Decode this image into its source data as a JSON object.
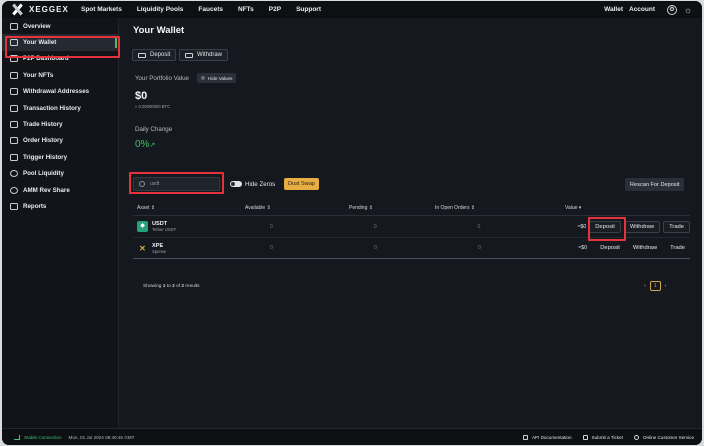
{
  "brand": {
    "name": "XEGGEX"
  },
  "topnav": {
    "items": [
      "Spot Markets",
      "Liquidity Pools",
      "Faucets",
      "NFTs",
      "P2P",
      "Support"
    ],
    "wallet": "Wallet",
    "account": "Account"
  },
  "sidebar": {
    "items": [
      {
        "label": "Overview",
        "icon": "overview-icon"
      },
      {
        "label": "Your Wallet",
        "icon": "wallet-icon"
      },
      {
        "label": "P2P Dashboard",
        "icon": "p2p-icon"
      },
      {
        "label": "Your NFTs",
        "icon": "nft-icon"
      },
      {
        "label": "Withdrawal Addresses",
        "icon": "address-book-icon"
      },
      {
        "label": "Transaction History",
        "icon": "history-icon"
      },
      {
        "label": "Trade History",
        "icon": "trade-history-icon"
      },
      {
        "label": "Order History",
        "icon": "order-history-icon"
      },
      {
        "label": "Trigger History",
        "icon": "trigger-icon"
      },
      {
        "label": "Pool Liquidity",
        "icon": "pool-icon"
      },
      {
        "label": "AMM Rev Share",
        "icon": "share-icon"
      },
      {
        "label": "Reports",
        "icon": "report-icon"
      }
    ]
  },
  "wallet": {
    "title": "Your Wallet",
    "deposit_label": "Deposit",
    "withdraw_label": "Withdraw",
    "portfolio_label": "Your Portfolio Value",
    "hide_values_label": "Hide Values",
    "balance": "$0",
    "balance_btc": "≈ 0.00000000 BTC",
    "daily_change_label": "Daily Change",
    "daily_change": "0%"
  },
  "filters": {
    "search_value": "usdt",
    "hide_zeros_label": "Hide Zeros",
    "dust_swap_label": "Dust Swap",
    "rescan_label": "Rescan For Deposit"
  },
  "table": {
    "headers": {
      "asset": "Asset ⇕",
      "available": "Available ⇕",
      "pending": "Pending ⇕",
      "open": "In Open Orders ⇕",
      "value": "Value ▾"
    },
    "rows": [
      {
        "symbol": "USDT",
        "name": "Tether USDT",
        "available": "0",
        "pending": "0",
        "open": "0",
        "value": "≈$0"
      },
      {
        "symbol": "XPE",
        "name": "Xpense",
        "available": "0",
        "pending": "0",
        "open": "0",
        "value": "≈$0"
      }
    ],
    "action_deposit": "Deposit",
    "action_withdraw": "Withdraw",
    "action_trade": "Trade"
  },
  "pagination": {
    "showing_prefix": "Showing ",
    "from": "1",
    "to_word": " to ",
    "to": "2",
    "of_word": " of ",
    "total": "2",
    "results_word": " results",
    "current_page": "1",
    "prev": "‹",
    "next": "›"
  },
  "statusbar": {
    "connection": "Stable Connection",
    "datetime": "Mon, 01 Jul 2024 08:40:45 GMT",
    "api_docs": "API Documentation",
    "submit_ticket": "Submit a Ticket",
    "customer_service": "Online Customer Service"
  },
  "colors": {
    "accent_gold": "#e9ae43",
    "positive_green": "#3fbf6a",
    "highlight_red": "#e4333c"
  }
}
